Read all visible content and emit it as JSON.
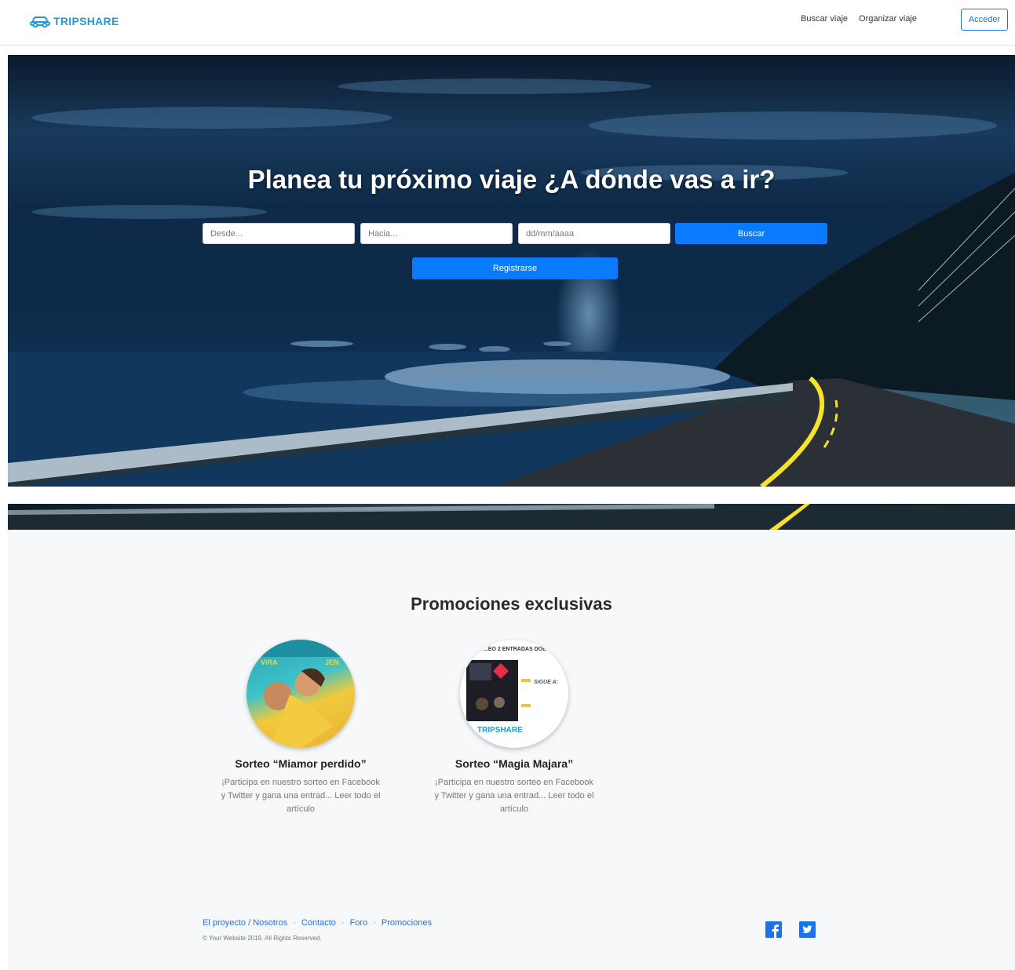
{
  "navbar": {
    "brand": "TRIPSHARE",
    "links": [
      "Buscar viaje",
      "Organizar viaje"
    ],
    "login_label": "Acceder"
  },
  "hero": {
    "title": "Planea tu próximo viaje ¿A dónde vas a ir?",
    "from_placeholder": "Desde...",
    "to_placeholder": "Hacia...",
    "date_placeholder": "dd/mm/aaaa",
    "search_label": "Buscar",
    "register_label": "Registrarse"
  },
  "promos": {
    "title": "Promociones exclusivas",
    "items": [
      {
        "title": "Sorteo “Miamor perdido”",
        "text": "¡Participa en nuestro sorteo en Facebook y Twitter y gana una entrad... Leer todo el artículo",
        "image_text": [
          "VIRA",
          "JEN"
        ]
      },
      {
        "title": "Sorteo “Magia Majara”",
        "text": "¡Participa en nuestro sorteo en Facebook y Twitter y gana una entrad... Leer todo el artículo",
        "image_text": [
          "...EO 2 ENTRADAS DOB...",
          "SIGUE A:",
          "TRIPSHARE"
        ]
      }
    ]
  },
  "footer": {
    "links": [
      "El proyecto / Nosotros",
      "Contacto",
      "Foro",
      "Promociones"
    ],
    "separator": "·",
    "copyright": "© Your Website 2019. All Rights Reserved."
  },
  "colors": {
    "brand": "#1c9bd6",
    "primary": "#0a7bff",
    "link": "#1a73e8"
  },
  "icons": {
    "brand": "car-icon",
    "social": [
      "facebook-icon",
      "twitter-icon"
    ]
  }
}
